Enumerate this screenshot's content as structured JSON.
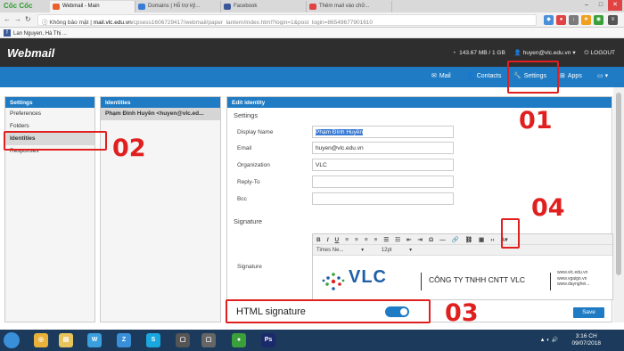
{
  "browser": {
    "brand": "Cốc Cốc",
    "tabs": [
      {
        "label": "Webmail - Main",
        "color": "#e8622c",
        "active": true
      },
      {
        "label": "Domains | Hỗ trợ kỹ...",
        "color": "#3a7bd5",
        "active": false
      },
      {
        "label": "Facebook",
        "color": "#3b5998",
        "active": false
      },
      {
        "label": "Thêm mail vào chữ...",
        "color": "#e04343",
        "active": false
      }
    ],
    "security_label": "Không bảo mật",
    "url_host": "mail.vlc.edu.vn",
    "url_path": "/cpsess1606729417/webmail/paper_lantern/index.html?login=1&post_login=86549677901610",
    "bookmark": "Lan Nguyen, Hà Thị ..."
  },
  "webmail": {
    "logo": "Webmail",
    "quota": "143.67 MB / 1 GB",
    "user": "huyen@vlc.edu.vn",
    "logout": "LOGOUT",
    "nav": {
      "mail": "Mail",
      "contacts": "Contacts",
      "settings": "Settings",
      "apps": "Apps"
    }
  },
  "settings_panel": {
    "title": "Settings",
    "items": [
      "Preferences",
      "Folders",
      "Identities",
      "Responses"
    ],
    "selected": "Identities"
  },
  "identities_panel": {
    "title": "Identities",
    "rows": [
      "Phạm Đình Huyền <huyen@vlc.ed..."
    ]
  },
  "edit_identity": {
    "title": "Edit identity",
    "settings_heading": "Settings",
    "fields": {
      "display_name": {
        "label": "Display Name",
        "value": "Phạm Đình Huyền"
      },
      "email": {
        "label": "Email",
        "value": "huyen@vlc.edu.vn"
      },
      "organization": {
        "label": "Organization",
        "value": "VLC"
      },
      "reply_to": {
        "label": "Reply-To",
        "value": ""
      },
      "bcc": {
        "label": "Bcc",
        "value": ""
      }
    },
    "signature_heading": "Signature",
    "signature_label": "Signature",
    "editor": {
      "font": "Times Ne...",
      "size": "12pt",
      "logo_text": "VLC",
      "company": "CÔNG TY TNHH CNTT VLC",
      "links": [
        "www.vlc.edu.vn",
        "www.vgaigo.vn",
        "www.daynghei..."
      ]
    },
    "html_signature_label": "HTML signature",
    "html_signature_on": true,
    "save_label": "Save"
  },
  "annotations": {
    "n1": "01",
    "n2": "02",
    "n3": "03",
    "n4": "04"
  },
  "taskbar": {
    "time": "3:16 CH",
    "date": "09/07/2018"
  },
  "colors": {
    "accent": "#1e7bc4",
    "annotation": "#e0201f",
    "header": "#2e2e2e"
  }
}
